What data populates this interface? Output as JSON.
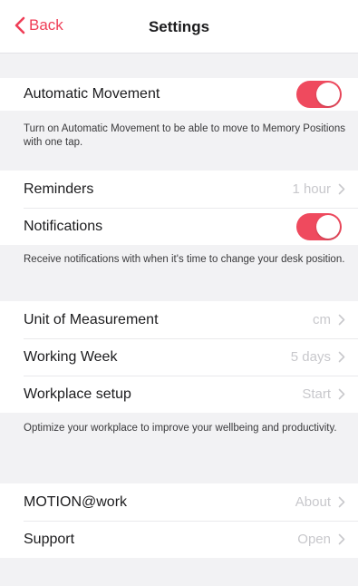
{
  "header": {
    "back_label": "Back",
    "title": "Settings"
  },
  "movement": {
    "label": "Automatic Movement",
    "toggle_on": true,
    "footer": "Turn on Automatic Movement to be able to move to Memory Positions with one tap."
  },
  "alerts": {
    "reminders_label": "Reminders",
    "reminders_value": "1 hour",
    "notifications_label": "Notifications",
    "notifications_on": true,
    "footer": "Receive notifications with when it's time to change your desk position."
  },
  "preferences": {
    "unit_label": "Unit of Measurement",
    "unit_value": "cm",
    "week_label": "Working Week",
    "week_value": "5 days",
    "workplace_label": "Workplace setup",
    "workplace_value": "Start",
    "footer": "Optimize your workplace to improve your wellbeing and productivity."
  },
  "about": {
    "motion_label": "MOTION@work",
    "motion_value": "About",
    "support_label": "Support",
    "support_value": "Open"
  },
  "colors": {
    "accent": "#ef4a5e",
    "background": "#f2f2f4",
    "value_text": "#c8c8cc"
  }
}
